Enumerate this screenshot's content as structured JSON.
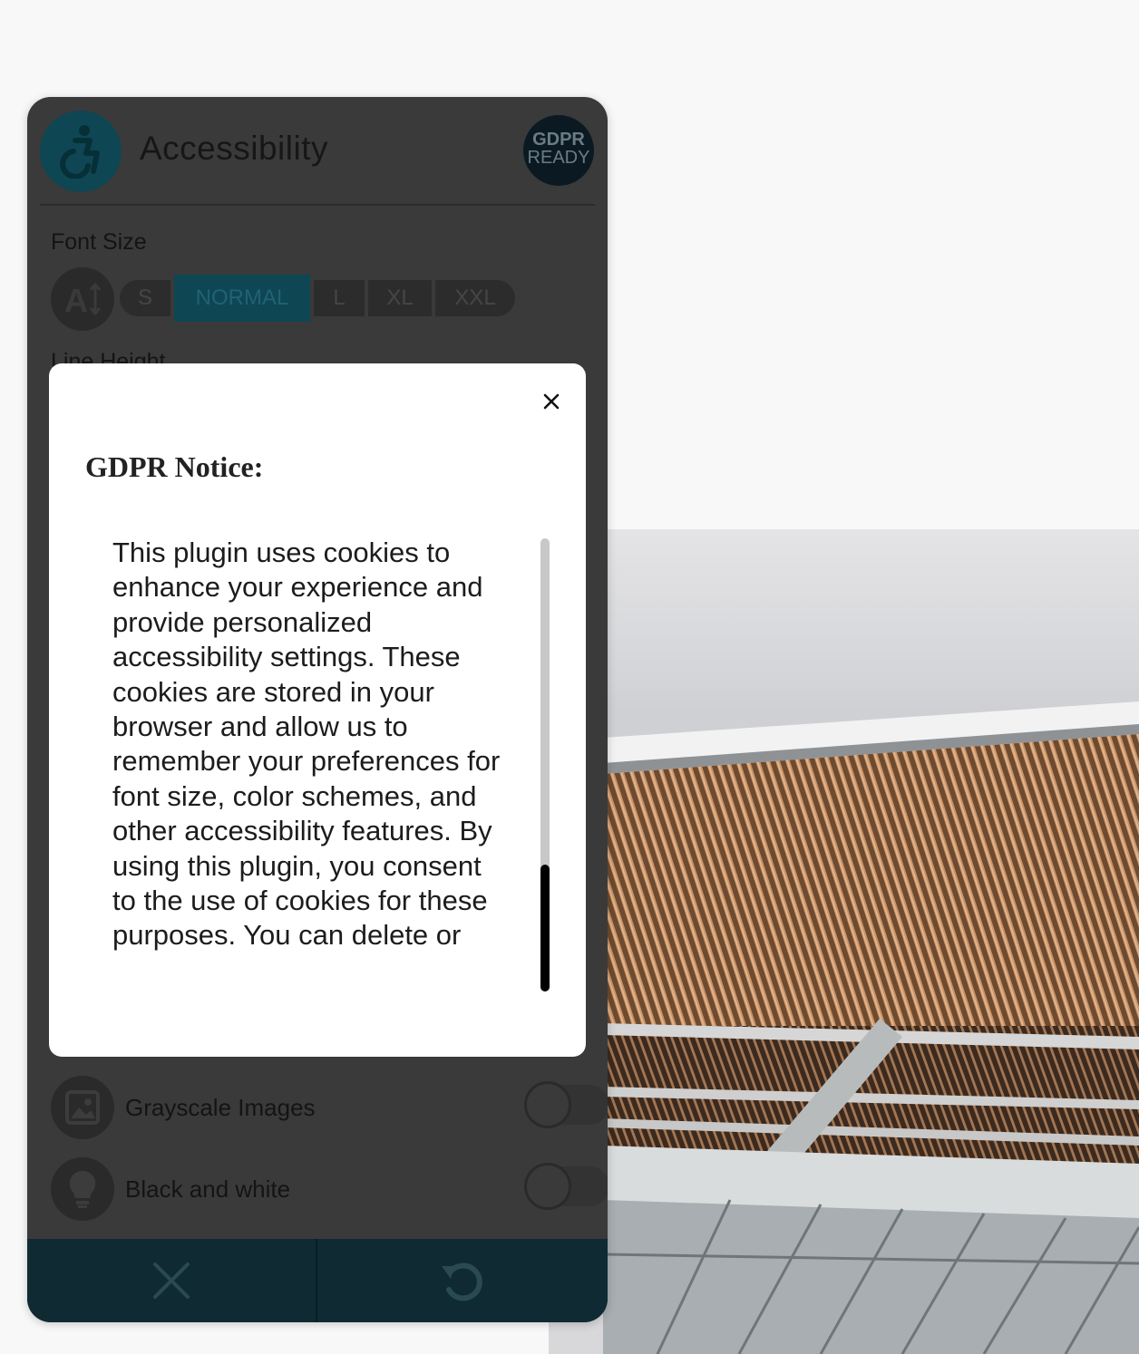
{
  "panel": {
    "title": "Accessibility",
    "gdpr_badge": {
      "line1": "GDPR",
      "line2": "READY"
    },
    "font_size": {
      "label": "Font Size",
      "options": [
        "S",
        "NORMAL",
        "L",
        "XL",
        "XXL"
      ],
      "selected": "NORMAL"
    },
    "line_height": {
      "label": "Line Height"
    },
    "options": [
      {
        "label": "Grayscale Images",
        "icon": "image-icon",
        "enabled": false
      },
      {
        "label": "Black and white",
        "icon": "lightbulb-icon",
        "enabled": false
      }
    ],
    "footer": {
      "close_icon": "close-icon",
      "reset_icon": "reset-icon"
    },
    "colors": {
      "accent": "#0f4653",
      "footer": "#0f2a32",
      "panel": "#3a3a3a"
    }
  },
  "modal": {
    "title": "GDPR Notice:",
    "body": "This plugin uses cookies to enhance your experience and provide personalized accessibility settings. These cookies are stored in your browser and allow us to remember your preferences for font size, color schemes, and other accessibility features. By using this plugin, you consent to the use of cookies for these purposes. You can delete or",
    "close_icon": "close-icon"
  }
}
